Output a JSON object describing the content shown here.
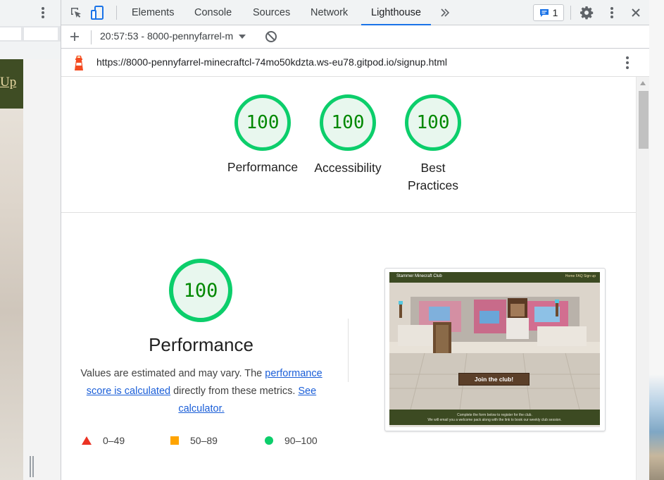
{
  "left_page": {
    "header_fragment": "Up"
  },
  "devtools": {
    "tabs": [
      {
        "label": "Elements",
        "active": false
      },
      {
        "label": "Console",
        "active": false
      },
      {
        "label": "Sources",
        "active": false
      },
      {
        "label": "Network",
        "active": false
      },
      {
        "label": "Lighthouse",
        "active": true
      }
    ],
    "more_tabs_icon": "double-chevron-right",
    "issues_count": "1",
    "report_selector": "20:57:53 - 8000-pennyfarrel-m",
    "url": "https://8000-pennyfarrel-minecraftcl-74mo50kdzta.ws-eu78.gitpod.io/signup.html",
    "accent_color": "#1a73e8",
    "pass_color": "#0cce6b"
  },
  "report": {
    "scores": [
      {
        "score": "100",
        "label": "Performance"
      },
      {
        "score": "100",
        "label": "Accessibility"
      },
      {
        "score": "100",
        "label": "Best Practices"
      }
    ],
    "performance": {
      "score": "100",
      "title": "Performance",
      "desc_before": "Values are estimated and may vary. The ",
      "desc_link1": "performance score is calculated",
      "desc_middle": " directly from these metrics. ",
      "desc_link2": "See calculator.",
      "legend": [
        {
          "range": "0–49",
          "shape": "triangle",
          "color": "#eb3223"
        },
        {
          "range": "50–89",
          "shape": "square",
          "color": "#ffa400"
        },
        {
          "range": "90–100",
          "shape": "circle",
          "color": "#0cce6b"
        }
      ]
    },
    "screenshot": {
      "site_title": "Stammer Minecraft Club",
      "nav": "Home  FAQ  Sign up",
      "cta": "Join the club!",
      "footer_line1": "Complete the form below to register for the club.",
      "footer_line2": "We will email you a welcome pack along with the link to book our weekly club session."
    }
  }
}
